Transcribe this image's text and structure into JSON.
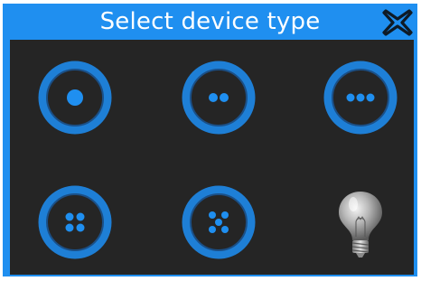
{
  "dialog": {
    "title": "Select device type",
    "close_icon": "close-x-icon"
  },
  "colors": {
    "title_bar": "#1f8ff0",
    "panel_background": "#252525",
    "ring": "#1e7fd6",
    "ring_inner": "#1b4f86",
    "dot": "#1f8ff0",
    "close_stroke": "#0e1a26"
  },
  "device_types": [
    {
      "icon": "one-dot-button-icon",
      "dots": 1
    },
    {
      "icon": "two-dot-button-icon",
      "dots": 2
    },
    {
      "icon": "three-dot-button-icon",
      "dots": 3
    },
    {
      "icon": "four-dot-button-icon",
      "dots": 4
    },
    {
      "icon": "five-dot-button-icon",
      "dots": 5
    },
    {
      "icon": "light-bulb-icon",
      "dots": 0
    }
  ]
}
